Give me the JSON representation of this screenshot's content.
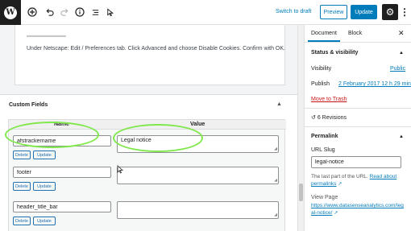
{
  "toolbar": {
    "logo": "W",
    "icons": [
      "add-block-icon",
      "undo-icon",
      "redo-icon",
      "info-icon",
      "list-view-icon",
      "tools-icon"
    ],
    "switch_to_draft": "Switch to draft",
    "preview": "Preview",
    "update": "Update"
  },
  "editor": {
    "netscape_text": "Under Netscape: Edit / Preferences tab. Click Advanced and choose Disable Cookies. Confirm with OK."
  },
  "custom_fields": {
    "title": "Custom Fields",
    "col_name": "Name",
    "col_value": "Value",
    "delete_label": "Delete",
    "update_label": "Update",
    "rows": [
      {
        "name": "afstrackername",
        "value": "Legal notice"
      },
      {
        "name": "footer",
        "value": ""
      },
      {
        "name": "header_title_bar",
        "value": ""
      }
    ]
  },
  "sidebar": {
    "tab_document": "Document",
    "tab_block": "Block",
    "status_title": "Status & visibility",
    "visibility_label": "Visibility",
    "visibility_value": "Public",
    "publish_label": "Publish",
    "publish_value": "2 February 2017 12 h 29 min",
    "move_to_trash": "Move to Trash",
    "revisions": "6 Revisions",
    "permalink_title": "Permalink",
    "url_slug_label": "URL Slug",
    "url_slug_value": "legal-notice",
    "help_text": "The last part of the URL.",
    "read_about": "Read about",
    "permalinks": "permalinks",
    "view_page_label": "View Page",
    "view_page_url_1": "https://www.datasenseanalytics.com/leg",
    "view_page_url_2": "al-notice/"
  },
  "colors": {
    "accent": "#007cba",
    "highlight_ring": "#7fe84a",
    "trash": "#cc1818"
  }
}
